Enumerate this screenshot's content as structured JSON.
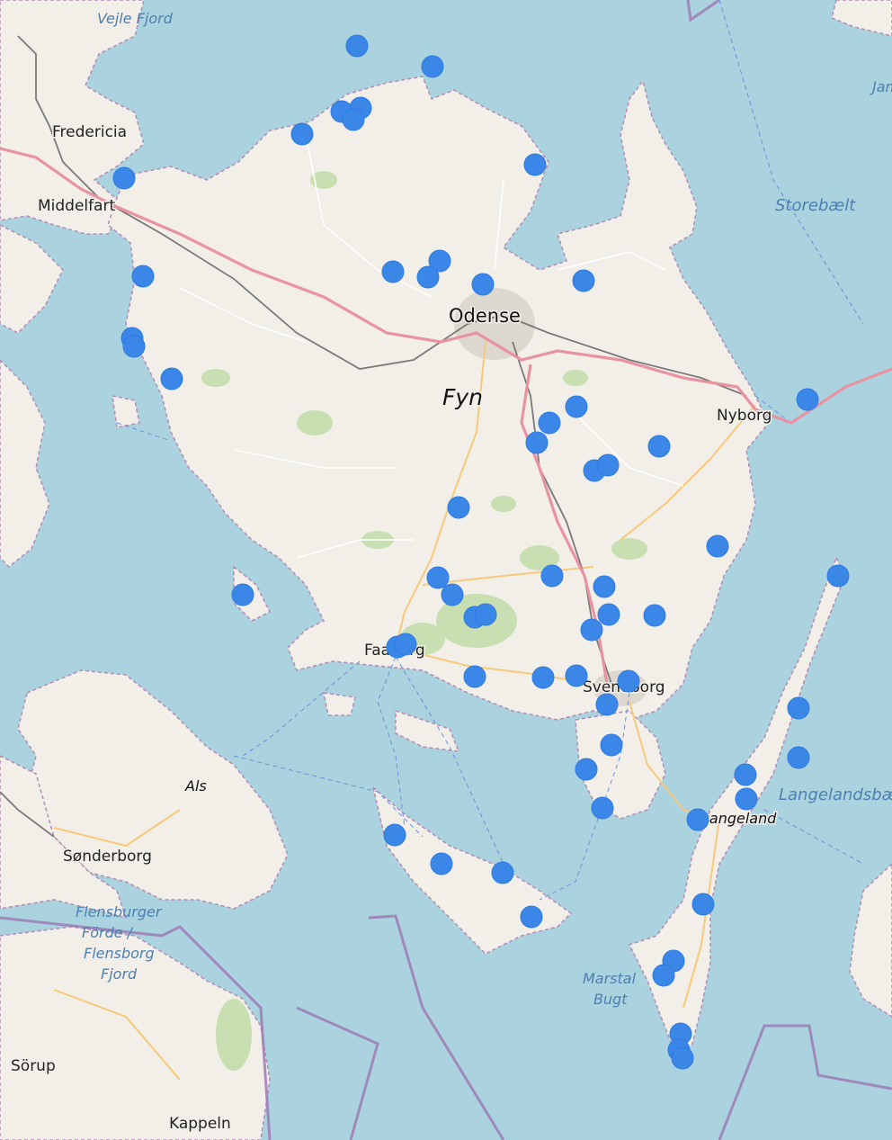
{
  "labels": {
    "fyn": "Fyn",
    "odense": "Odense",
    "nyborg": "Nyborg",
    "middelfart": "Middelfart",
    "fredericia": "Fredericia",
    "faaborg": "Faaborg",
    "svendborg": "Svendborg",
    "langeland": "Langeland",
    "als": "Als",
    "sonderborg": "Sønderborg",
    "sorup": "Sörup",
    "kappeln": "Kappeln",
    "vejle_fjord": "Vejle Fjord",
    "storebaelt": "Storebælt",
    "langelandsbaelt": "Langelandsbælt",
    "flensburg_1": "Flensburger",
    "flensburg_2": "Förde /",
    "flensburg_3": "Flensborg",
    "flensburg_4": "Fjord",
    "marstal_1": "Marstal",
    "marstal_2": "Bugt",
    "jammerland": "Jam"
  },
  "colors": {
    "water": "#aad3df",
    "land": "#f2efe9",
    "marker": "#3b87e8",
    "motorway": "#e892a2",
    "border": "#9e7bb5"
  },
  "markers_count": 64
}
